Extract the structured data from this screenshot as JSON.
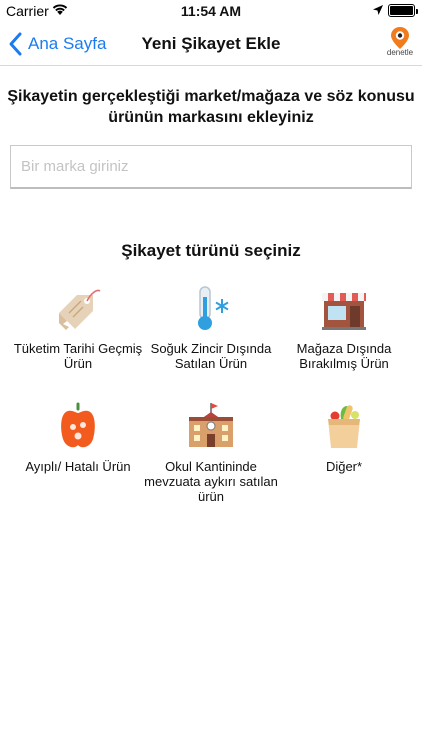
{
  "status_bar": {
    "carrier": "Carrier",
    "time": "11:54 AM"
  },
  "nav": {
    "back_label": "Ana Sayfa",
    "title": "Yeni Şikayet Ekle",
    "logo_text": "denetle"
  },
  "heading": "Şikayetin gerçekleştiği market/mağaza ve söz konusu ürünün markasını ekleyiniz",
  "brand_input": {
    "placeholder": "Bir marka giriniz",
    "value": ""
  },
  "type_heading": "Şikayet türünü seçiniz",
  "categories": [
    {
      "label": "Tüketim Tarihi Geçmiş Ürün",
      "icon": "price-tag-icon"
    },
    {
      "label": "Soğuk Zincir Dışında Satılan Ürün",
      "icon": "thermometer-snow-icon"
    },
    {
      "label": "Mağaza Dışında Bırakılmış Ürün",
      "icon": "storefront-icon"
    },
    {
      "label": "Ayıplı/ Hatalı Ürün",
      "icon": "rotten-pepper-icon"
    },
    {
      "label": "Okul Kantininde mevzuata aykırı satılan ürün",
      "icon": "school-building-icon"
    },
    {
      "label": "Diğer*",
      "icon": "grocery-bag-icon"
    }
  ],
  "colors": {
    "accent": "#1a7cf0",
    "logo_orange": "#f07c1e"
  }
}
